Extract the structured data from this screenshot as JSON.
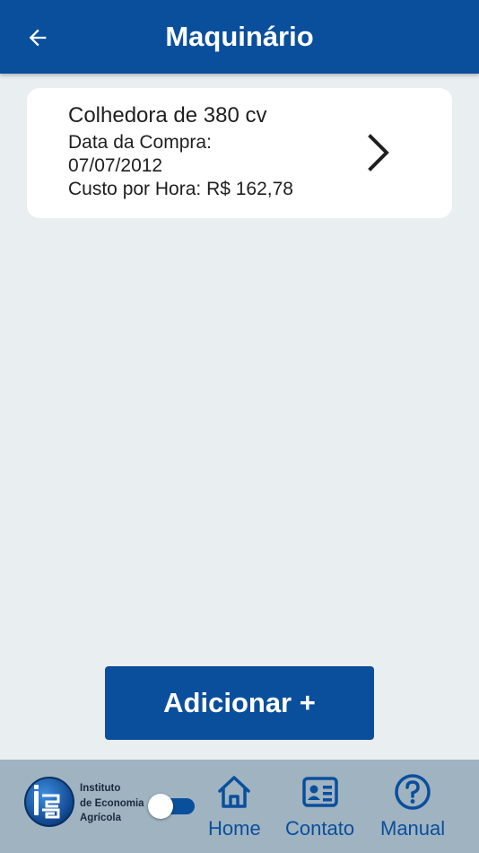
{
  "header": {
    "title": "Maquinário",
    "back_icon": "arrow-left-icon"
  },
  "machines": [
    {
      "name": "Colhedora de 380 cv",
      "purchase_label": "Data da Compra:",
      "purchase_date": "07/07/2012",
      "cost_text": "Custo por Hora: R$ 162,78",
      "chevron_icon": "chevron-right-icon"
    }
  ],
  "actions": {
    "add_label": "Adicionar +"
  },
  "footer": {
    "logo": {
      "mark": "iea",
      "lines": [
        "Instituto",
        "de Economia",
        "Agrícola"
      ]
    },
    "toggle_on": true,
    "nav": [
      {
        "label": "Home",
        "icon": "home-icon"
      },
      {
        "label": "Contato",
        "icon": "contact-card-icon"
      },
      {
        "label": "Manual",
        "icon": "help-circle-icon"
      }
    ]
  },
  "colors": {
    "primary": "#0a4f9c",
    "background": "#e9eef0",
    "footer": "#9fb3c1",
    "card": "#ffffff"
  }
}
